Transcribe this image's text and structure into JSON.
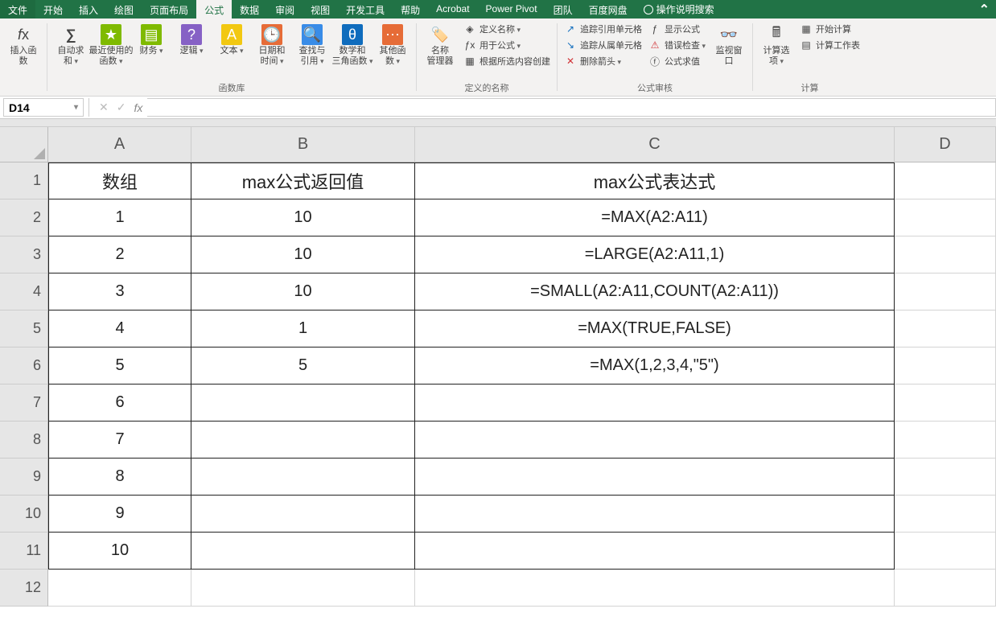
{
  "menu": {
    "items": [
      "文件",
      "开始",
      "插入",
      "绘图",
      "页面布局",
      "公式",
      "数据",
      "审阅",
      "视图",
      "开发工具",
      "帮助",
      "Acrobat",
      "Power Pivot",
      "团队",
      "百度网盘"
    ],
    "active_index": 5,
    "tell_me": "操作说明搜索"
  },
  "ribbon": {
    "insert_function": "插入函数",
    "library": {
      "title": "函数库",
      "autosum": "自动求和",
      "recent": "最近使用的\n函数",
      "financial": "财务",
      "logical": "逻辑",
      "text": "文本",
      "datetime": "日期和时间",
      "lookup": "查找与引用",
      "math": "数学和\n三角函数",
      "more": "其他函数"
    },
    "names": {
      "title": "定义的名称",
      "manager": "名称\n管理器",
      "define": "定义名称",
      "use": "用于公式",
      "create": "根据所选内容创建"
    },
    "audit": {
      "title": "公式审核",
      "trace_prec": "追踪引用单元格",
      "trace_dep": "追踪从属单元格",
      "remove": "删除箭头",
      "show": "显示公式",
      "error": "错误检查",
      "eval": "公式求值",
      "watch": "监视窗口"
    },
    "calc": {
      "title": "计算",
      "options": "计算选项",
      "now": "开始计算",
      "sheet": "计算工作表"
    }
  },
  "namebox": "D14",
  "formula": "",
  "columns": [
    "A",
    "B",
    "C",
    "D"
  ],
  "row_labels": [
    "1",
    "2",
    "3",
    "4",
    "5",
    "6",
    "7",
    "8",
    "9",
    "10",
    "11",
    "12"
  ],
  "sheet": {
    "header": {
      "A": "数组",
      "B": "max公式返回值",
      "C": "max公式表达式"
    },
    "rows": [
      {
        "A": "1",
        "B": "10",
        "C": "=MAX(A2:A11)"
      },
      {
        "A": "2",
        "B": "10",
        "C": "=LARGE(A2:A11,1)"
      },
      {
        "A": "3",
        "B": "10",
        "C": "=SMALL(A2:A11,COUNT(A2:A11))"
      },
      {
        "A": "4",
        "B": "1",
        "C": "=MAX(TRUE,FALSE)"
      },
      {
        "A": "5",
        "B": "5",
        "C": "=MAX(1,2,3,4,\"5\")"
      },
      {
        "A": "6",
        "B": "",
        "C": ""
      },
      {
        "A": "7",
        "B": "",
        "C": ""
      },
      {
        "A": "8",
        "B": "",
        "C": ""
      },
      {
        "A": "9",
        "B": "",
        "C": ""
      },
      {
        "A": "10",
        "B": "",
        "C": ""
      }
    ]
  }
}
